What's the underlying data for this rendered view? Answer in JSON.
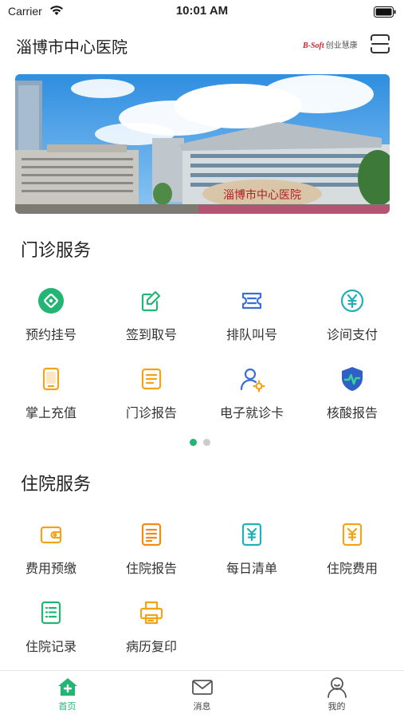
{
  "status_bar": {
    "carrier": "Carrier",
    "time": "10:01 AM"
  },
  "header": {
    "title": "淄博市中心医院",
    "brand_latin": "B-Soft",
    "brand_zh": "创业慧康"
  },
  "banner": {
    "image_text": "淄博市中心医院"
  },
  "outpatient": {
    "title": "门诊服务",
    "items": [
      {
        "label": "预约挂号",
        "icon": "register-icon"
      },
      {
        "label": "签到取号",
        "icon": "checkin-icon"
      },
      {
        "label": "排队叫号",
        "icon": "queue-ticket-icon"
      },
      {
        "label": "诊间支付",
        "icon": "yuan-payment-icon"
      },
      {
        "label": "掌上充值",
        "icon": "phone-recharge-icon"
      },
      {
        "label": "门诊报告",
        "icon": "report-icon"
      },
      {
        "label": "电子就诊卡",
        "icon": "user-card-icon"
      },
      {
        "label": "核酸报告",
        "icon": "shield-health-icon"
      }
    ],
    "pager": {
      "pages": 2,
      "active": 1
    }
  },
  "inpatient": {
    "title": "住院服务",
    "items": [
      {
        "label": "费用预缴",
        "icon": "wallet-icon"
      },
      {
        "label": "住院报告",
        "icon": "report-icon"
      },
      {
        "label": "每日清单",
        "icon": "yuan-bill-icon"
      },
      {
        "label": "住院费用",
        "icon": "yuan-doc-icon"
      },
      {
        "label": "住院记录",
        "icon": "list-icon"
      },
      {
        "label": "病历复印",
        "icon": "printer-icon"
      }
    ]
  },
  "tabbar": {
    "items": [
      {
        "label": "首页",
        "icon": "home-icon",
        "active": true
      },
      {
        "label": "消息",
        "icon": "mail-icon",
        "active": false
      },
      {
        "label": "我的",
        "icon": "profile-icon",
        "active": false
      }
    ]
  },
  "colors": {
    "accent": "#22b573",
    "orange": "#f2a318",
    "blue": "#3a6fd8",
    "teal": "#22b0b8",
    "brand_red": "#d0242b"
  }
}
